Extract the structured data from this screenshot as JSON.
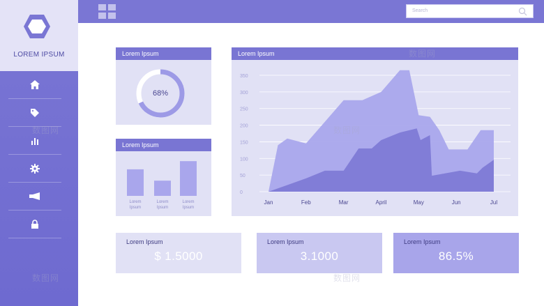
{
  "brand": {
    "name": "LOREM IPSUM"
  },
  "topbar": {
    "search_placeholder": "Search"
  },
  "sidebar": {
    "items": [
      {
        "icon": "home-icon"
      },
      {
        "icon": "tag-icon"
      },
      {
        "icon": "bar-chart-icon"
      },
      {
        "icon": "gear-icon"
      },
      {
        "icon": "megaphone-icon"
      },
      {
        "icon": "lock-icon"
      }
    ]
  },
  "donut_card": {
    "title": "Lorem Ipsum",
    "percent_label": "68%",
    "percent": 68
  },
  "bars_card": {
    "title": "Lorem Ipsum",
    "bars": [
      {
        "label": "Lorem Ipsum",
        "value": 0.68
      },
      {
        "label": "Lorem Ipsum",
        "value": 0.39
      },
      {
        "label": "Lorem Ipsum",
        "value": 0.89
      }
    ]
  },
  "area_card": {
    "title": "Lorem Ipsum"
  },
  "stats": [
    {
      "title": "Lorem Ipsum",
      "value": "$ 1.5000"
    },
    {
      "title": "Lorem Ipsum",
      "value": "3.1000"
    },
    {
      "title": "Lorem Ipsum",
      "value": "86.5%"
    }
  ],
  "watermark": {
    "text": "数图网"
  },
  "colors": {
    "accent": "#7a76d4",
    "card": "#e1e1f5",
    "area_light": "#a9a6ec",
    "area_dark": "#7e7ad6"
  },
  "chart_data": {
    "type": "area",
    "categories": [
      "Jan",
      "Feb",
      "Mar",
      "April",
      "May",
      "Jun",
      "Jul"
    ],
    "yticks": [
      0,
      50,
      100,
      150,
      200,
      250,
      300,
      350
    ],
    "ylim": [
      0,
      350
    ],
    "grid": true,
    "series": [
      {
        "x": [
          0,
          0.25,
          0.5,
          1.0,
          1.5,
          2.0,
          2.5,
          3.0,
          3.5,
          3.75,
          4.0,
          4.3,
          4.55,
          4.8,
          5.3,
          5.65,
          6.0
        ],
        "values": [
          0,
          140,
          160,
          145,
          210,
          275,
          275,
          300,
          365,
          365,
          230,
          225,
          185,
          127,
          127,
          185,
          185
        ]
      },
      {
        "x": [
          0,
          0.5,
          1.0,
          1.5,
          2.0,
          2.4,
          2.75,
          3.0,
          3.5,
          3.95,
          4.05,
          4.3,
          4.35,
          4.7,
          5.1,
          5.55,
          5.7,
          6.0
        ],
        "values": [
          0,
          20,
          40,
          63,
          63,
          130,
          130,
          155,
          178,
          190,
          155,
          170,
          48,
          55,
          63,
          55,
          72,
          96
        ]
      }
    ]
  }
}
